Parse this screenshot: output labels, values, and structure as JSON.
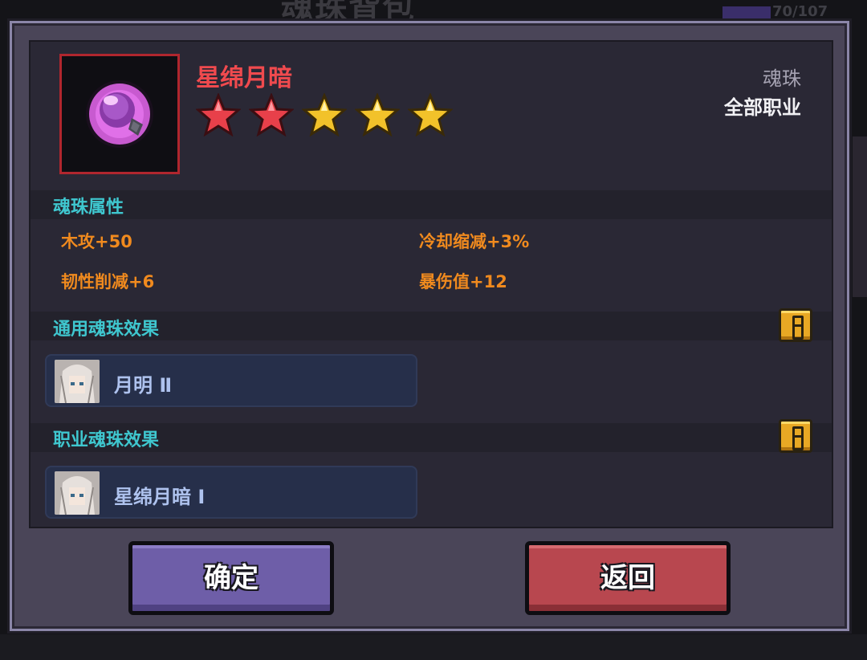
{
  "background": {
    "title": "魂珠背包",
    "count": "70/107"
  },
  "item": {
    "name": "星绵月暗",
    "stars_total": 5,
    "stars_red": 2,
    "type": "魂珠",
    "class": "全部职业",
    "icon": "soul-orb-icon"
  },
  "attributes": {
    "title": "魂珠属性",
    "items": [
      "木攻+50",
      "冷却缩减+3%",
      "韧性削减+6",
      "暴伤值+12"
    ]
  },
  "general_effects": {
    "title": "通用魂珠效果",
    "entries": [
      {
        "label": "月明 Ⅱ",
        "icon": "character-avatar"
      }
    ]
  },
  "class_effects": {
    "title": "职业魂珠效果",
    "entries": [
      {
        "label": "星绵月暗 Ⅰ",
        "icon": "character-avatar"
      }
    ]
  },
  "buttons": {
    "confirm": "确定",
    "back": "返回"
  },
  "colors": {
    "name_red": "#f04a4e",
    "section_cyan": "#3fc7cf",
    "attribute_orange": "#f08a1e",
    "confirm_purple": "#6e5ea8",
    "back_red": "#b8474f"
  }
}
